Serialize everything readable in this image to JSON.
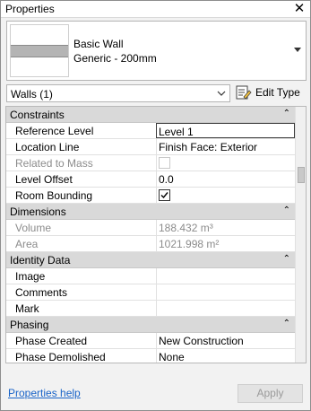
{
  "window": {
    "title": "Properties"
  },
  "type_selector": {
    "family": "Basic Wall",
    "type": "Generic - 200mm"
  },
  "instance_filter": {
    "selected": "Walls (1)"
  },
  "edit_type": {
    "label": "Edit Type"
  },
  "sections": {
    "constraints": {
      "label": "Constraints",
      "reference_level": {
        "name": "Reference Level",
        "value": "Level 1"
      },
      "location_line": {
        "name": "Location Line",
        "value": "Finish Face: Exterior"
      },
      "related_to_mass": {
        "name": "Related to Mass",
        "checked": false
      },
      "level_offset": {
        "name": "Level Offset",
        "value": "0.0"
      },
      "room_bounding": {
        "name": "Room Bounding",
        "checked": true
      }
    },
    "dimensions": {
      "label": "Dimensions",
      "volume": {
        "name": "Volume",
        "value": "188.432 m³"
      },
      "area": {
        "name": "Area",
        "value": "1021.998 m²"
      }
    },
    "identity_data": {
      "label": "Identity Data",
      "image": {
        "name": "Image",
        "value": ""
      },
      "comments": {
        "name": "Comments",
        "value": ""
      },
      "mark": {
        "name": "Mark",
        "value": ""
      }
    },
    "phasing": {
      "label": "Phasing",
      "phase_created": {
        "name": "Phase Created",
        "value": "New Construction"
      },
      "phase_demolished": {
        "name": "Phase Demolished",
        "value": "None"
      }
    }
  },
  "footer": {
    "help_link": "Properties help",
    "apply_label": "Apply"
  },
  "colors": {
    "link": "#1a64c8",
    "section_bg": "#d9d9d9",
    "disabled_text": "#8c8c8c"
  },
  "icons": {
    "close": "close-icon",
    "type_dropdown": "dropdown-arrow-icon",
    "instance_dropdown": "chevron-down-icon",
    "edit_type": "edit-type-icon",
    "collapse": "collapse-section-icon"
  }
}
